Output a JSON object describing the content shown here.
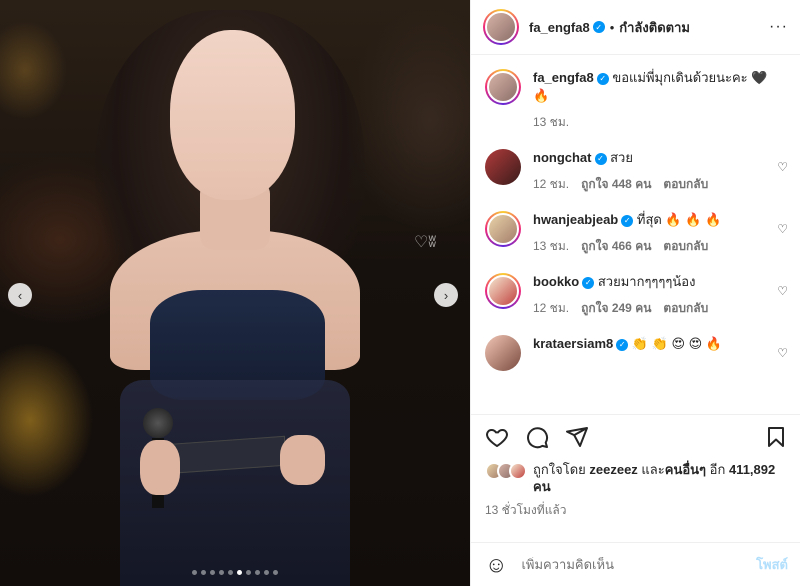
{
  "header": {
    "username": "fa_engfa8",
    "separator": "•",
    "follow_status": "กำลังติดตาม",
    "more": "···"
  },
  "caption": {
    "username": "fa_engfa8",
    "text": "ขอแม่พี่มุกเดินด้วยนะคะ 🖤 🔥",
    "time": "13 ชม."
  },
  "comments": [
    {
      "username": "nongchat",
      "text": "สวย",
      "time": "12 ชม.",
      "likes": "ถูกใจ 448 คน",
      "reply": "ตอบกลับ"
    },
    {
      "username": "hwanjeabjeab",
      "text": "ที่สุด 🔥 🔥 🔥",
      "time": "13 ชม.",
      "likes": "ถูกใจ 466 คน",
      "reply": "ตอบกลับ"
    },
    {
      "username": "bookko",
      "text": "สวยมากๆๆๆๆน้อง",
      "time": "12 ชม.",
      "likes": "ถูกใจ 249 คน",
      "reply": "ตอบกลับ"
    },
    {
      "username": "krataersiam8",
      "text": "👏 👏 😍 😍 🔥"
    }
  ],
  "likes": {
    "prefix": "ถูกใจโดย",
    "user": "zeezeez",
    "joiner": "และ",
    "others": "คนอื่นๆ",
    "count_prefix": "อีก",
    "count": "411,892 คน"
  },
  "time_ago": "13 ชั่วโมงที่แล้ว",
  "add_comment": {
    "placeholder": "เพิ่มความคิดเห็น",
    "post_label": "โพสต์"
  },
  "media": {
    "watermark": "♡ʬ",
    "prev": "‹",
    "next": "›",
    "slide_count": 10,
    "active_slide": 5
  },
  "colors": {
    "verified": "#0095f6",
    "post_button": "#b2dffc",
    "secondary_text": "#737373"
  }
}
